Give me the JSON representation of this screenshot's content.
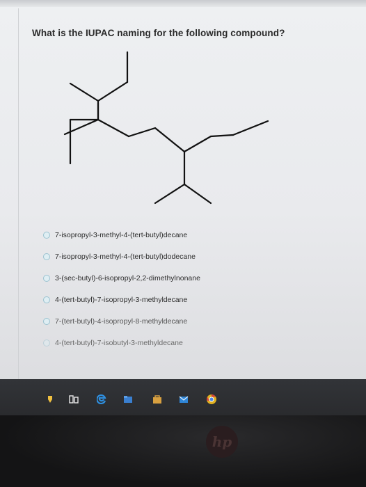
{
  "question": "What is the IUPAC naming for the following compound?",
  "options": [
    "7-isopropyl-3-methyl-4-(tert-butyl)decane",
    "7-isopropyl-3-methyl-4-(tert-butyl)dodecane",
    "3-(sec-butyl)-6-isopropyl-2,2-dimethylnonane",
    "4-(tert-butyl)-7-isopropyl-3-methyldecane",
    "7-(tert-butyl)-4-isopropyl-8-methyldecane",
    "4-(tert-butyl)-7-isobutyl-3-methyldecane"
  ],
  "selected_option": null,
  "taskbar": {
    "icons": [
      "pin-icon",
      "task-view-icon",
      "edge-browser-icon",
      "file-explorer-icon",
      "store-icon",
      "mail-icon",
      "chrome-icon"
    ]
  },
  "brand": "hp",
  "colors": {
    "structure_line": "#111111",
    "radio_fill": "#dfeef3",
    "taskbar": "#2e3033"
  }
}
